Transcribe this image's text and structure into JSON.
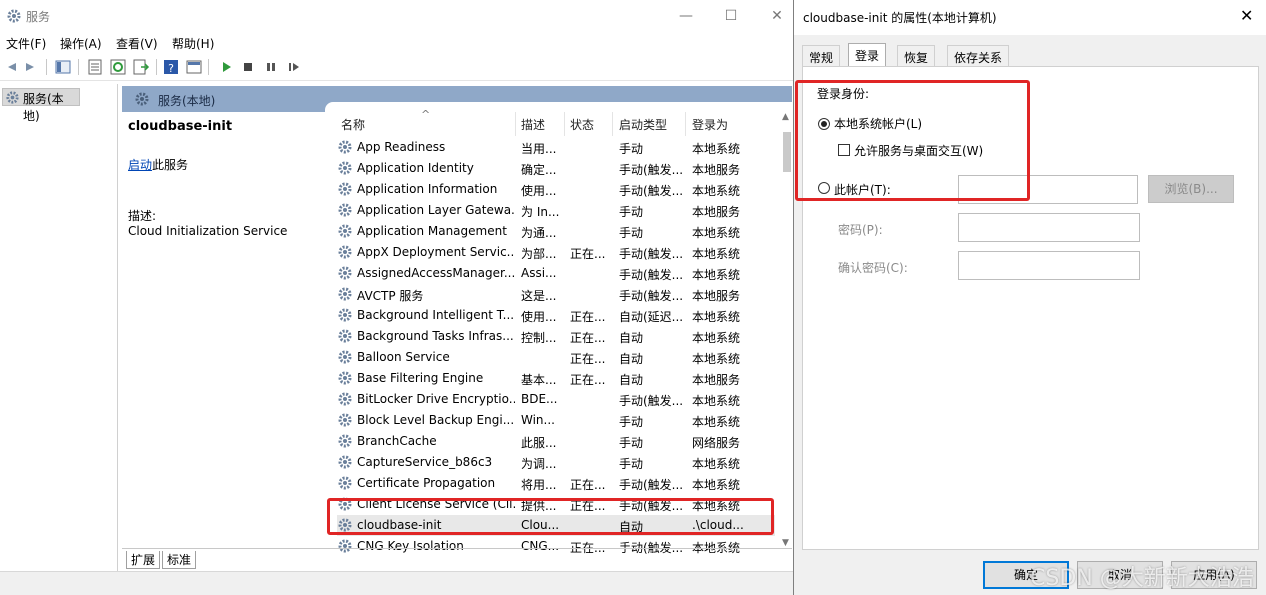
{
  "main_window": {
    "title": "服务",
    "controls": {
      "minimize": "—",
      "maximize": "☐",
      "close": "✕"
    },
    "menu": [
      "文件(F)",
      "操作(A)",
      "查看(V)",
      "帮助(H)"
    ],
    "tree_item": "服务(本地)",
    "pane_header": "服务(本地)",
    "detail": {
      "service_name": "cloudbase-init",
      "start_link": "启动",
      "start_suffix": "此服务",
      "desc_label": "描述:",
      "desc_text": "Cloud Initialization Service"
    },
    "columns": [
      "名称",
      "描述",
      "状态",
      "启动类型",
      "登录为"
    ],
    "sort_indicator": "^",
    "rows": [
      {
        "name": "App Readiness",
        "desc": "当用...",
        "state": "",
        "type": "手动",
        "logon": "本地系统"
      },
      {
        "name": "Application Identity",
        "desc": "确定...",
        "state": "",
        "type": "手动(触发...",
        "logon": "本地服务"
      },
      {
        "name": "Application Information",
        "desc": "使用...",
        "state": "",
        "type": "手动(触发...",
        "logon": "本地系统"
      },
      {
        "name": "Application Layer Gatewa...",
        "desc": "为 In...",
        "state": "",
        "type": "手动",
        "logon": "本地服务"
      },
      {
        "name": "Application Management",
        "desc": "为通...",
        "state": "",
        "type": "手动",
        "logon": "本地系统"
      },
      {
        "name": "AppX Deployment Servic...",
        "desc": "为部...",
        "state": "正在...",
        "type": "手动(触发...",
        "logon": "本地系统"
      },
      {
        "name": "AssignedAccessManager...",
        "desc": "Assi...",
        "state": "",
        "type": "手动(触发...",
        "logon": "本地系统"
      },
      {
        "name": "AVCTP 服务",
        "desc": "这是...",
        "state": "",
        "type": "手动(触发...",
        "logon": "本地服务"
      },
      {
        "name": "Background Intelligent T...",
        "desc": "使用...",
        "state": "正在...",
        "type": "自动(延迟...",
        "logon": "本地系统"
      },
      {
        "name": "Background Tasks Infras...",
        "desc": "控制...",
        "state": "正在...",
        "type": "自动",
        "logon": "本地系统"
      },
      {
        "name": "Balloon Service",
        "desc": "",
        "state": "正在...",
        "type": "自动",
        "logon": "本地系统"
      },
      {
        "name": "Base Filtering Engine",
        "desc": "基本...",
        "state": "正在...",
        "type": "自动",
        "logon": "本地服务"
      },
      {
        "name": "BitLocker Drive Encryptio...",
        "desc": "BDE...",
        "state": "",
        "type": "手动(触发...",
        "logon": "本地系统"
      },
      {
        "name": "Block Level Backup Engi...",
        "desc": "Win...",
        "state": "",
        "type": "手动",
        "logon": "本地系统"
      },
      {
        "name": "BranchCache",
        "desc": "此服...",
        "state": "",
        "type": "手动",
        "logon": "网络服务"
      },
      {
        "name": "CaptureService_b86c3",
        "desc": "为调...",
        "state": "",
        "type": "手动",
        "logon": "本地系统"
      },
      {
        "name": "Certificate Propagation",
        "desc": "将用...",
        "state": "正在...",
        "type": "手动(触发...",
        "logon": "本地系统"
      },
      {
        "name": "Client License Service (Cli...",
        "desc": "提供...",
        "state": "正在...",
        "type": "手动(触发...",
        "logon": "本地系统"
      },
      {
        "name": "cloudbase-init",
        "desc": "Clou...",
        "state": "",
        "type": "自动",
        "logon": ".\\cloud..."
      },
      {
        "name": "CNG Key Isolation",
        "desc": "CNG...",
        "state": "正在...",
        "type": "手动(触发...",
        "logon": "本地系统"
      }
    ],
    "bottom_tabs": [
      "扩展",
      "标准"
    ]
  },
  "dialog": {
    "title": "cloudbase-init 的属性(本地计算机)",
    "close": "✕",
    "tabs": [
      "常规",
      "登录",
      "恢复",
      "依存关系"
    ],
    "active_tab": "登录",
    "logon_as_label": "登录身份:",
    "local_system_label": "本地系统帐户(L)",
    "allow_desktop_label": "允许服务与桌面交互(W)",
    "this_account_label": "此帐户(T):",
    "browse_button": "浏览(B)...",
    "password_label": "密码(P):",
    "confirm_password_label": "确认密码(C):",
    "ok_button": "确定",
    "cancel_button": "取消",
    "apply_button": "应用(A)"
  },
  "watermark": "CSDN @大新新大浩浩",
  "colors": {
    "highlight_box": "#e02525",
    "pane_header": "#8fa8c8",
    "link": "#0045b5"
  }
}
